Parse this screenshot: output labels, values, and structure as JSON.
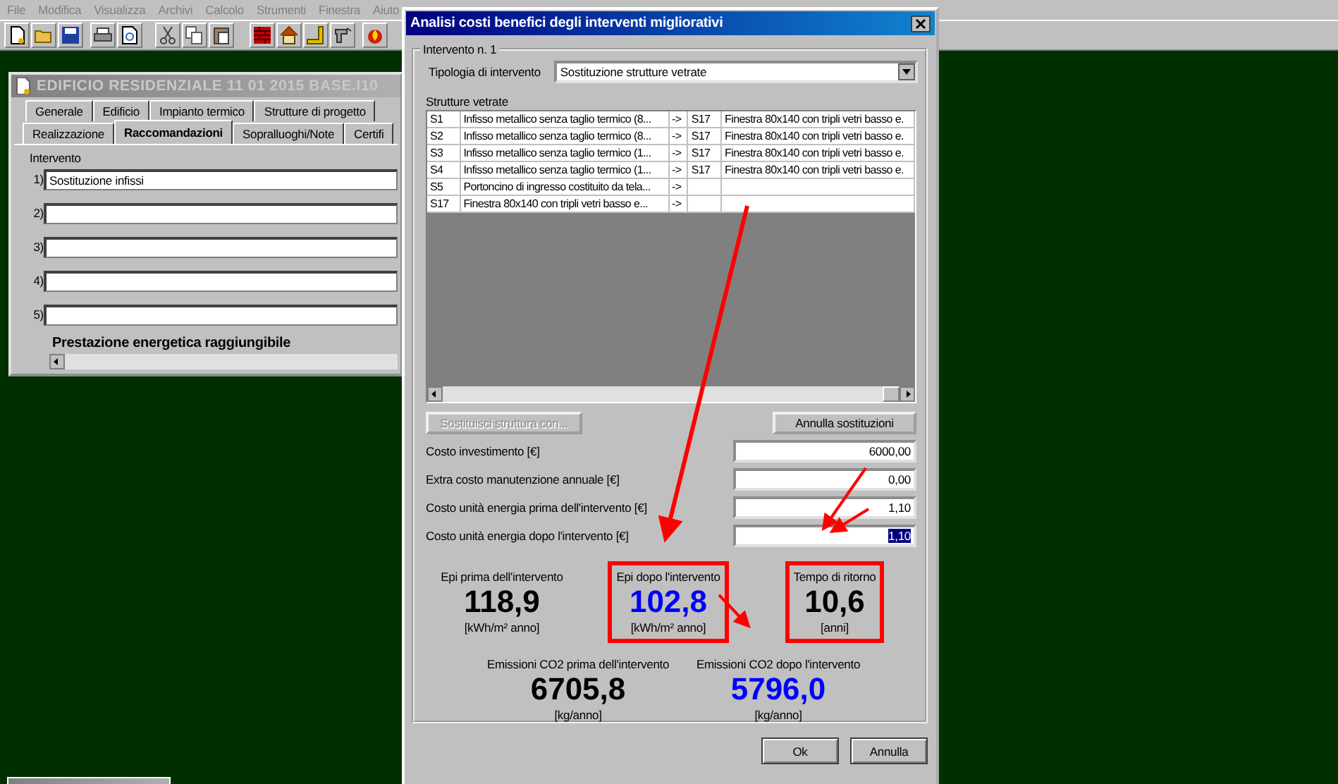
{
  "menu": [
    {
      "label": "File",
      "disabled": true
    },
    {
      "label": "Modifica",
      "disabled": true
    },
    {
      "label": "Visualizza",
      "disabled": true
    },
    {
      "label": "Archivi",
      "disabled": true
    },
    {
      "label": "Calcolo",
      "disabled": true
    },
    {
      "label": "Strumenti",
      "disabled": true
    },
    {
      "label": "Finestra",
      "disabled": true
    },
    {
      "label": "Aiuto",
      "disabled": true
    }
  ],
  "child_window": {
    "title": "EDIFICIO RESIDENZIALE 11 01 2015 BASE.I10",
    "active": false,
    "tabs_row_1": [
      {
        "label": "Generale",
        "selected": false
      },
      {
        "label": "Edificio",
        "selected": false
      },
      {
        "label": "Impianto termico",
        "selected": false
      },
      {
        "label": "Strutture di progetto",
        "selected": false
      }
    ],
    "tabs_row_2": [
      {
        "label": "Realizzazione",
        "selected": false
      },
      {
        "label": "Raccomandazioni",
        "selected": true
      },
      {
        "label": "Sopralluoghi/Note",
        "selected": false
      },
      {
        "label": "Certifi",
        "selected": false
      }
    ],
    "intervention_label": "Intervento",
    "interventions": [
      {
        "number": "1)",
        "value": "Sostituzione infissi"
      },
      {
        "number": "2)"
      },
      {
        "number": "3)"
      },
      {
        "number": "4)"
      },
      {
        "number": "5)"
      }
    ],
    "section_heading": "Prestazione energetica raggiungibile"
  },
  "dialog": {
    "title": "Analisi costi benefici degli interventi migliorativi",
    "group_label": "Intervento n. 1",
    "type_label": "Tipologia di intervento",
    "type_value": "Sostituzione strutture vetrate",
    "table_label": "Strutture vetrate",
    "rows": [
      {
        "code": "S1",
        "description": "Infisso metallico senza taglio termico (8...",
        "arrow": "->",
        "new_code": "S17",
        "new_description": "Finestra 80x140 con tripli vetri basso e."
      },
      {
        "code": "S2",
        "description": "Infisso metallico senza taglio termico (8...",
        "arrow": "->",
        "new_code": "S17",
        "new_description": "Finestra 80x140 con tripli vetri basso e."
      },
      {
        "code": "S3",
        "description": "Infisso metallico senza taglio termico (1...",
        "arrow": "->",
        "new_code": "S17",
        "new_description": "Finestra 80x140 con tripli vetri basso e."
      },
      {
        "code": "S4",
        "description": "Infisso metallico senza taglio termico (1...",
        "arrow": "->",
        "new_code": "S17",
        "new_description": "Finestra 80x140 con tripli vetri basso e."
      },
      {
        "code": "S5",
        "description": "Portoncino di ingresso costituito da tela...",
        "arrow": "->"
      },
      {
        "code": "S17",
        "description": "Finestra 80x140 con tripli vetri basso e...",
        "arrow": "->"
      }
    ],
    "action_buttons": [
      {
        "label": "Sostituisci struttura con...",
        "disabled": true
      },
      {
        "label": "Annulla sostituzioni",
        "disabled": false
      }
    ],
    "fields": [
      {
        "label": "Costo investimento [€]",
        "value": "6000,00",
        "text_selected": false
      },
      {
        "label": "Extra costo manutenzione annuale [€]",
        "value": "0,00",
        "text_selected": false
      },
      {
        "label": "Costo unità energia prima dell'intervento [€]",
        "value": "1,10",
        "text_selected": false
      },
      {
        "label": "Costo unità energia dopo l'intervento [€]",
        "value": "1,10",
        "text_selected": true
      }
    ],
    "results_row_1": [
      {
        "label": "Epi prima dell'intervento",
        "value": "118,9",
        "unit": "[kWh/m² anno]",
        "color": "#000000",
        "highlighted": false
      },
      {
        "label": "Epi dopo l'intervento",
        "value": "102,8",
        "unit": "[kWh/m² anno]",
        "color": "#0000ff",
        "highlighted": true
      },
      {
        "label": "Tempo di ritorno",
        "value": "10,6",
        "unit": "[anni]",
        "color": "#000000",
        "highlighted": true
      }
    ],
    "results_row_2": [
      {
        "label": "Emissioni CO2 prima dell'intervento",
        "value": "6705,8",
        "unit": "[kg/anno]",
        "color": "#000000",
        "highlighted": false
      },
      {
        "label": "Emissioni CO2 dopo l'intervento",
        "value": "5796,0",
        "unit": "[kg/anno]",
        "color": "#0000ff",
        "highlighted": false
      }
    ],
    "buttons": [
      {
        "label": "Ok"
      },
      {
        "label": "Annulla"
      }
    ]
  }
}
